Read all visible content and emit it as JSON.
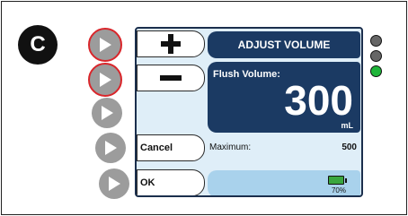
{
  "step_badge": "C",
  "screen": {
    "title": "ADJUST VOLUME",
    "buttons": {
      "plus": "plus",
      "minus": "minus",
      "cancel": "Cancel",
      "ok": "OK"
    },
    "volume_label": "Flush Volume:",
    "volume_value": "300",
    "volume_unit": "mL",
    "maximum_label": "Maximum:",
    "maximum_value": "500",
    "battery_percent": "70%"
  },
  "soft_keys": [
    {
      "id": "soft-key-1",
      "highlighted": true
    },
    {
      "id": "soft-key-2",
      "highlighted": true
    },
    {
      "id": "soft-key-3",
      "highlighted": false
    },
    {
      "id": "soft-key-4",
      "highlighted": false
    },
    {
      "id": "soft-key-5",
      "highlighted": false
    }
  ],
  "status_leds": [
    {
      "name": "led-1",
      "color": "#666666"
    },
    {
      "name": "led-2",
      "color": "#666666"
    },
    {
      "name": "led-3",
      "color": "#1fb53a"
    }
  ],
  "colors": {
    "panel_dark": "#1b3a63",
    "screen_bg": "#dfeef8",
    "highlight_ring": "#d9262b"
  }
}
